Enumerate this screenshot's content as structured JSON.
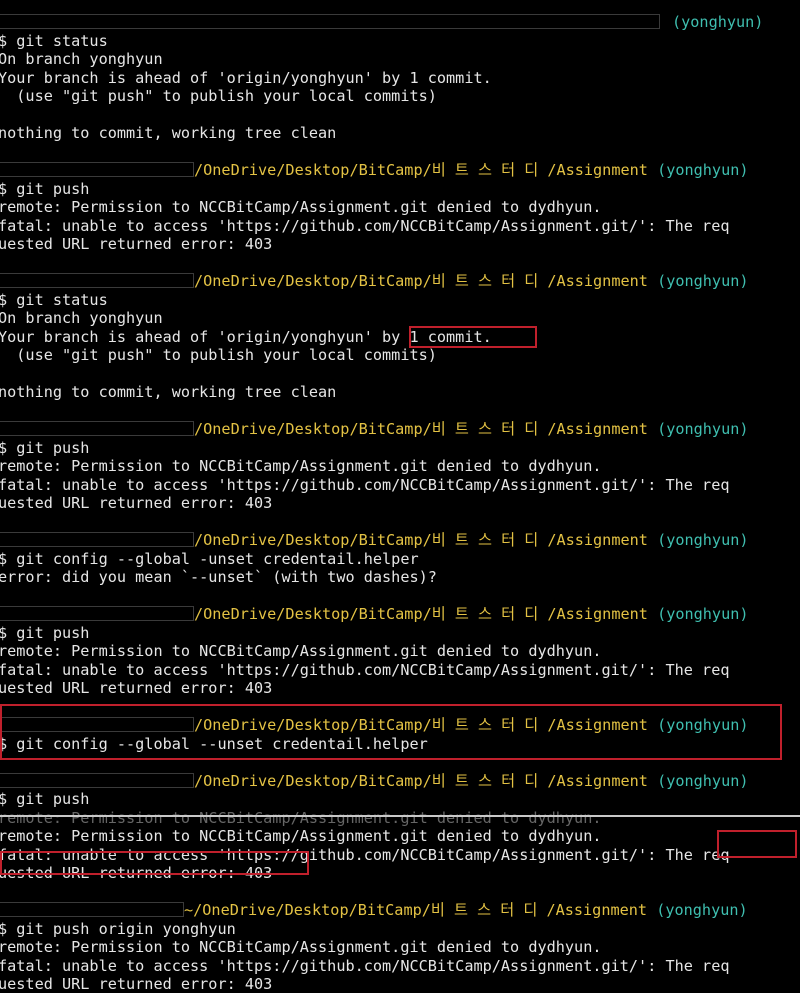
{
  "terminal": {
    "lines": [
      {
        "type": "prompt",
        "redact": true,
        "path": "",
        "branch": "(yonghyun)"
      },
      {
        "type": "text",
        "text": "$ git status"
      },
      {
        "type": "text",
        "text": "On branch yonghyun"
      },
      {
        "type": "text",
        "text": "Your branch is ahead of 'origin/yonghyun' by 1 commit."
      },
      {
        "type": "text",
        "text": "  (use \"git push\" to publish your local commits)"
      },
      {
        "type": "blank"
      },
      {
        "type": "text",
        "text": "nothing to commit, working tree clean"
      },
      {
        "type": "blank"
      },
      {
        "type": "prompt",
        "redact": true,
        "path": "/OneDrive/Desktop/BitCamp/비 트 스 터 디 /Assignment",
        "branch": "(yonghyun)"
      },
      {
        "type": "text",
        "text": "$ git push"
      },
      {
        "type": "text",
        "text": "remote: Permission to NCCBitCamp/Assignment.git denied to dydhyun."
      },
      {
        "type": "text",
        "text": "fatal: unable to access 'https://github.com/NCCBitCamp/Assignment.git/': The req"
      },
      {
        "type": "text",
        "text": "uested URL returned error: 403"
      },
      {
        "type": "blank"
      },
      {
        "type": "prompt",
        "redact": true,
        "path": "/OneDrive/Desktop/BitCamp/비 트 스 터 디 /Assignment",
        "branch": "(yonghyun)"
      },
      {
        "type": "text",
        "text": "$ git status"
      },
      {
        "type": "text",
        "text": "On branch yonghyun"
      },
      {
        "type": "text",
        "text": "Your branch is ahead of 'origin/yonghyun' by 1 commit."
      },
      {
        "type": "text",
        "text": "  (use \"git push\" to publish your local commits)"
      },
      {
        "type": "blank"
      },
      {
        "type": "text",
        "text": "nothing to commit, working tree clean"
      },
      {
        "type": "blank"
      },
      {
        "type": "prompt",
        "redact": true,
        "path": "/OneDrive/Desktop/BitCamp/비 트 스 터 디 /Assignment",
        "branch": "(yonghyun)"
      },
      {
        "type": "text",
        "text": "$ git push"
      },
      {
        "type": "text",
        "text": "remote: Permission to NCCBitCamp/Assignment.git denied to dydhyun."
      },
      {
        "type": "text",
        "text": "fatal: unable to access 'https://github.com/NCCBitCamp/Assignment.git/': The req"
      },
      {
        "type": "text",
        "text": "uested URL returned error: 403"
      },
      {
        "type": "blank"
      },
      {
        "type": "prompt",
        "redact": true,
        "path": "/OneDrive/Desktop/BitCamp/비 트 스 터 디 /Assignment",
        "branch": "(yonghyun)"
      },
      {
        "type": "text",
        "text": "$ git config --global -unset credentail.helper"
      },
      {
        "type": "text",
        "text": "error: did you mean `--unset` (with two dashes)?"
      },
      {
        "type": "blank"
      },
      {
        "type": "prompt",
        "redact": true,
        "path": "/OneDrive/Desktop/BitCamp/비 트 스 터 디 /Assignment",
        "branch": "(yonghyun)"
      },
      {
        "type": "text",
        "text": "$ git push"
      },
      {
        "type": "text",
        "text": "remote: Permission to NCCBitCamp/Assignment.git denied to dydhyun."
      },
      {
        "type": "text",
        "text": "fatal: unable to access 'https://github.com/NCCBitCamp/Assignment.git/': The req"
      },
      {
        "type": "text",
        "text": "uested URL returned error: 403"
      },
      {
        "type": "blank"
      },
      {
        "type": "prompt",
        "redact": true,
        "path": "/OneDrive/Desktop/BitCamp/비 트 스 터 디 /Assignment",
        "branch": "(yonghyun)"
      },
      {
        "type": "text",
        "text": "$ git config --global --unset credentail.helper"
      },
      {
        "type": "blank"
      },
      {
        "type": "prompt",
        "redact": true,
        "path": "/OneDrive/Desktop/BitCamp/비 트 스 터 디 /Assignment",
        "branch": "(yonghyun)"
      },
      {
        "type": "text",
        "text": "$ git push"
      },
      {
        "type": "ghost",
        "text": "remote: Permission to NCCBitCamp/Assignment.git denied to dydhyun."
      },
      {
        "type": "text",
        "text": "remote: Permission to NCCBitCamp/Assignment.git denied to dydhyun."
      },
      {
        "type": "text",
        "text": "fatal: unable to access 'https://github.com/NCCBitCamp/Assignment.git/': The req"
      },
      {
        "type": "text",
        "text": "uested URL returned error: 403"
      },
      {
        "type": "blank"
      },
      {
        "type": "prompt",
        "redact": true,
        "path": "~/OneDrive/Desktop/BitCamp/비 트 스 터 디 /Assignment",
        "branch": "(yonghyun)"
      },
      {
        "type": "text",
        "text": "$ git push origin yonghyun"
      },
      {
        "type": "text",
        "text": "remote: Permission to NCCBitCamp/Assignment.git denied to dydhyun."
      },
      {
        "type": "text",
        "text": "fatal: unable to access 'https://github.com/NCCBitCamp/Assignment.git/': The req"
      },
      {
        "type": "text",
        "text": "uested URL returned error: 403"
      }
    ]
  },
  "colors": {
    "background": "#000000",
    "text": "#e6e6e6",
    "path": "#e3c244",
    "branch": "#3fbfb0",
    "highlight_box": "#c0202c"
  }
}
